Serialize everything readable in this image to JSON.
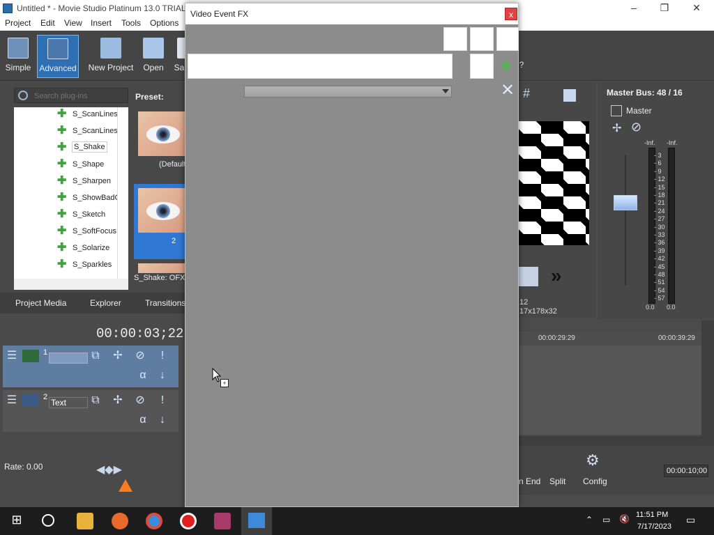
{
  "app": {
    "title": "Untitled * - Movie Studio Platinum 13.0 TRIAL",
    "window_controls": {
      "minimize": "–",
      "maximize": "❐",
      "close": "✕"
    }
  },
  "menu": [
    "Project",
    "Edit",
    "View",
    "Insert",
    "Tools",
    "Options"
  ],
  "toolbar": {
    "simple": "Simple",
    "advanced": "Advanced",
    "new_project": "New Project",
    "open": "Open",
    "save_partial": "Sa",
    "help_partial": "?"
  },
  "explorer": {
    "search_placeholder": "Search plug-ins",
    "preset_label": "Preset:",
    "plugins": [
      "S_ScanLines",
      "S_ScanLinesP",
      "S_Shake",
      "S_Shape",
      "S_Sharpen",
      "S_ShowBadC",
      "S_Sketch",
      "S_SoftFocus",
      "S_Solarize",
      "S_Sparkles"
    ],
    "selected_plugin": "S_Shake",
    "preset_default": "(Default",
    "preset_2": "2",
    "status": "S_Shake: OFX,"
  },
  "tabs": [
    "Project Media",
    "Explorer",
    "Transitions"
  ],
  "timeline": {
    "timecode": "00:00:03;22",
    "tracks": [
      {
        "number": "1",
        "name": ""
      },
      {
        "number": "2",
        "name": "Text"
      }
    ],
    "rate": "Rate: 0.00",
    "ruler": [
      "00:00:29:29",
      "00:00:39:29"
    ],
    "end_time": "00:00:10;00"
  },
  "preview": {
    "info1": "12",
    "info2": "17x178x32"
  },
  "master": {
    "title": "Master Bus: 48 / 16",
    "label": "Master",
    "inf_left": "-Inf.",
    "inf_right": "-Inf.",
    "scale": [
      "3",
      "6",
      "9",
      "12",
      "15",
      "18",
      "21",
      "24",
      "27",
      "30",
      "33",
      "36",
      "39",
      "42",
      "45",
      "48",
      "51",
      "54",
      "57"
    ],
    "bottom_left": "0.0",
    "bottom_right": "0.0"
  },
  "bottom_tools": {
    "end": "n End",
    "split": "Split",
    "config": "Config"
  },
  "dialog": {
    "title": "Video Event FX",
    "close": "x"
  },
  "taskbar": {
    "time": "11:51 PM",
    "date": "7/17/2023"
  }
}
